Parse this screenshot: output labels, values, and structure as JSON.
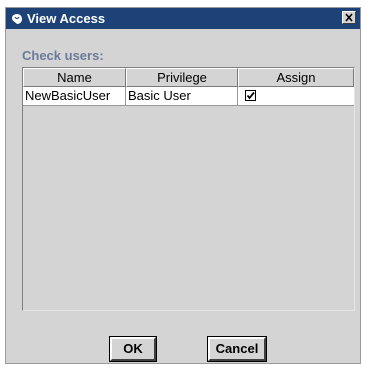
{
  "window": {
    "title": "View Access",
    "title_icon": "java-coffee-icon",
    "close_icon": "close-icon"
  },
  "section_label": "Check users:",
  "table": {
    "columns": [
      "Name",
      "Privilege",
      "Assign"
    ],
    "rows": [
      {
        "name": "NewBasicUser",
        "privilege": "Basic User",
        "assign": true
      }
    ]
  },
  "buttons": {
    "ok": "OK",
    "cancel": "Cancel"
  },
  "colors": {
    "title_bar": "#1c4277",
    "dialog_bg": "#d4d4d4",
    "label_color": "#6d7a9a"
  }
}
